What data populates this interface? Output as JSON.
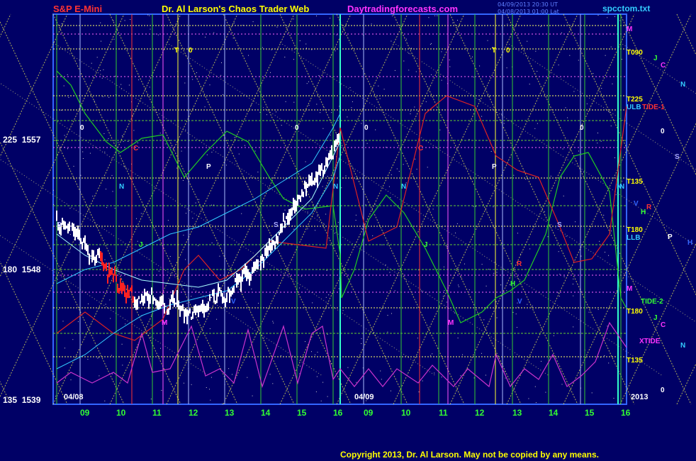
{
  "header": {
    "left": "S&P E-Mini",
    "center": "Dr. Al Larson's Chaos Trader Web",
    "site": "Daytradingforecasts.com",
    "stamp1": "04/09/2013 20:30 UT",
    "stamp2": "04/08/2013 01:00 Lat",
    "file": "spcctom.txt"
  },
  "colors": {
    "bg": "#000066",
    "title_red": "#ff3333",
    "title_yellow": "#ffff00",
    "site_magenta": "#ff33ff",
    "file_cyan": "#33ccff"
  },
  "chart_data": {
    "type": "line",
    "y_ticks": [
      {
        "angle": "225",
        "price": "1557",
        "value": 1557
      },
      {
        "angle": "180",
        "price": "1548",
        "value": 1548
      },
      {
        "angle": "135",
        "price": "1539",
        "value": 1539
      }
    ],
    "ylim": [
      1539,
      1557
    ],
    "x_ticks": [
      "09",
      "10",
      "11",
      "12",
      "13",
      "14",
      "15",
      "16",
      "09",
      "10",
      "11",
      "12",
      "13",
      "14",
      "15",
      "16"
    ],
    "dates": [
      "04/08",
      "04/09",
      "2013"
    ],
    "right_labels": [
      {
        "text": "M",
        "color": "#ff33ff"
      },
      {
        "text": "T090",
        "color": "#ffff00"
      },
      {
        "text": "J",
        "color": "#33ff33"
      },
      {
        "text": "C",
        "color": "#ff33ff"
      },
      {
        "text": "N",
        "color": "#33ccff"
      },
      {
        "text": "T225",
        "color": "#ffff00"
      },
      {
        "text": "ULB",
        "color": "#33ccff"
      },
      {
        "text": "TIDE-1",
        "color": "#ff3333"
      },
      {
        "text": "0",
        "color": "#ffffff"
      },
      {
        "text": "S",
        "color": "#aaaaff"
      },
      {
        "text": "T135",
        "color": "#ffff00"
      },
      {
        "text": "N",
        "color": "#33ccff"
      },
      {
        "text": "V",
        "color": "#3366ff"
      },
      {
        "text": "H",
        "color": "#33ff33"
      },
      {
        "text": "R",
        "color": "#ff3333"
      },
      {
        "text": "T180",
        "color": "#ffff00"
      },
      {
        "text": "LLB",
        "color": "#33ccff"
      },
      {
        "text": "P",
        "color": "#ffffff"
      },
      {
        "text": "H",
        "color": "#3366ff"
      },
      {
        "text": "M",
        "color": "#ff33ff"
      },
      {
        "text": "TIDE-2",
        "color": "#33ff33"
      },
      {
        "text": "T180",
        "color": "#ffff00"
      },
      {
        "text": "J",
        "color": "#33ff33"
      },
      {
        "text": "C",
        "color": "#ff33ff"
      },
      {
        "text": "XTIDE",
        "color": "#ff33ff"
      },
      {
        "text": "N",
        "color": "#33ccff"
      },
      {
        "text": "T135",
        "color": "#ffff00"
      },
      {
        "text": "0",
        "color": "#ffffff"
      }
    ],
    "in_chart_labels": [
      {
        "text": "T",
        "color": "#ffff00"
      },
      {
        "text": "0",
        "color": "#ffff00"
      },
      {
        "text": "T",
        "color": "#ffff00"
      },
      {
        "text": "0",
        "color": "#ffff00"
      },
      {
        "text": "0",
        "color": "#ffffff"
      },
      {
        "text": "0",
        "color": "#ffffff"
      },
      {
        "text": "0",
        "color": "#ffffff"
      },
      {
        "text": "0",
        "color": "#ffffff"
      },
      {
        "text": "C",
        "color": "#ff3333"
      },
      {
        "text": "C",
        "color": "#ff3333"
      },
      {
        "text": "P",
        "color": "#ffffff"
      },
      {
        "text": "P",
        "color": "#ffffff"
      },
      {
        "text": "N",
        "color": "#33ccff"
      },
      {
        "text": "N",
        "color": "#33ccff"
      },
      {
        "text": "N",
        "color": "#33ccff"
      },
      {
        "text": "N",
        "color": "#33ccff"
      },
      {
        "text": "S",
        "color": "#aaaaff"
      },
      {
        "text": "S",
        "color": "#aaaaff"
      },
      {
        "text": "S",
        "color": "#aaaaff"
      },
      {
        "text": "M",
        "color": "#ff33ff"
      },
      {
        "text": "M",
        "color": "#ff33ff"
      },
      {
        "text": "V",
        "color": "#3366ff"
      },
      {
        "text": "V",
        "color": "#3366ff"
      },
      {
        "text": "R",
        "color": "#ff3333"
      },
      {
        "text": "H",
        "color": "#33ff33"
      },
      {
        "text": "J",
        "color": "#33ff33"
      },
      {
        "text": "J",
        "color": "#33ff33"
      }
    ]
  },
  "footer": {
    "copyright": "Copyright 2013, Dr. Al Larson. May not be copied by any means."
  }
}
